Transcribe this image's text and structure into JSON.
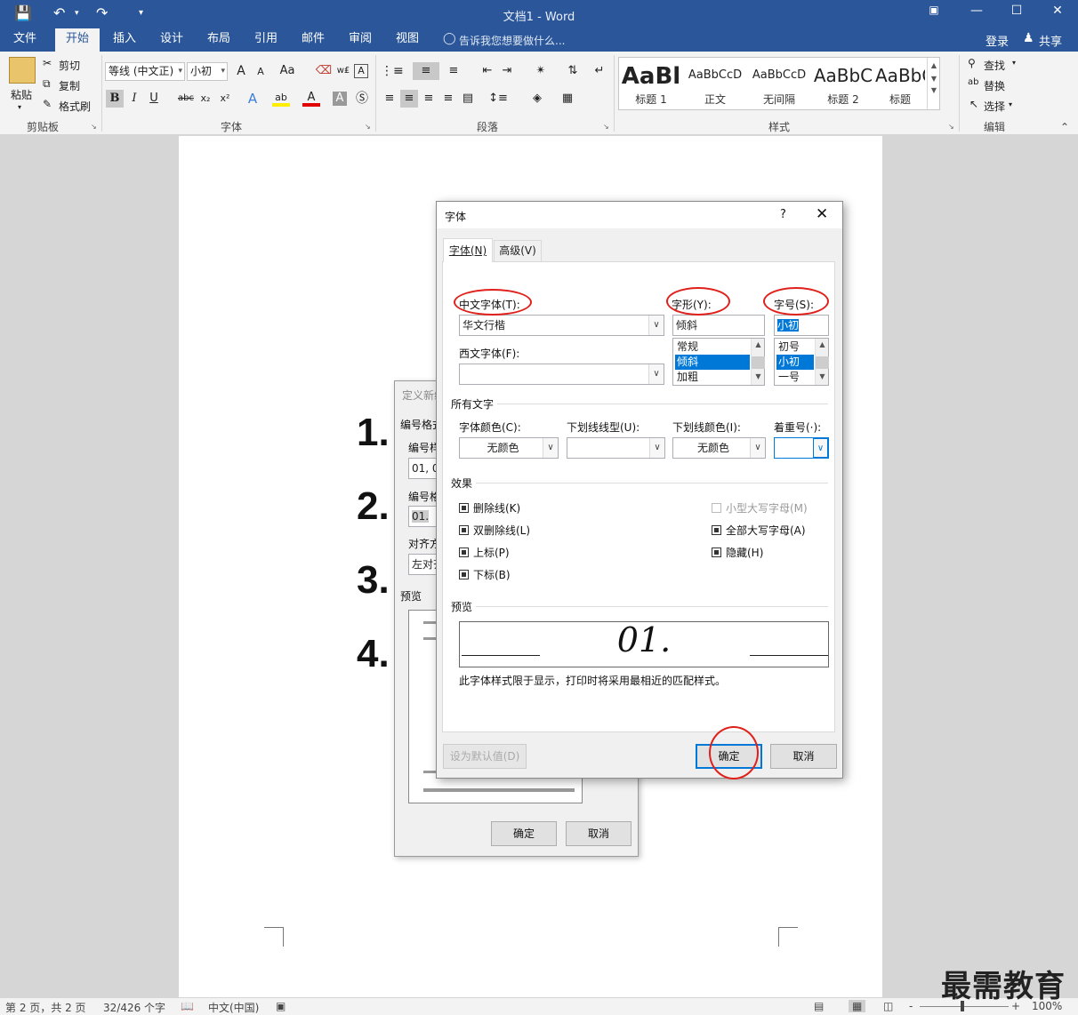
{
  "app": {
    "doc_title": "文档1 - Word",
    "quick_access": [
      "save-icon",
      "undo-icon",
      "redo-icon",
      "customize-icon"
    ]
  },
  "tabs": [
    "文件",
    "开始",
    "插入",
    "设计",
    "布局",
    "引用",
    "邮件",
    "审阅",
    "视图"
  ],
  "tell_me": "告诉我您想要做什么...",
  "account": {
    "login": "登录",
    "share": "共享"
  },
  "ribbon": {
    "clipboard": {
      "paste": "粘贴",
      "cut": "剪切",
      "copy": "复制",
      "format_painter": "格式刷",
      "label": "剪贴板"
    },
    "font": {
      "font_name": "等线 (中文正)",
      "font_size": "小初",
      "grow": "A",
      "shrink": "A",
      "change_case": "Aa",
      "label": "字体",
      "bold": "B",
      "italic": "I",
      "underline": "U",
      "strike": "abc",
      "subscript": "x₂",
      "superscript": "x²"
    },
    "paragraph": {
      "label": "段落"
    },
    "styles": {
      "label": "样式",
      "items": [
        {
          "preview": "AaBl",
          "name": "标题 1"
        },
        {
          "preview": "AaBbCcD",
          "name": "正文"
        },
        {
          "preview": "AaBbCcD",
          "name": "无间隔"
        },
        {
          "preview": "AaBbC",
          "name": "标题 2"
        },
        {
          "preview": "AaBbC",
          "name": "标题"
        }
      ]
    },
    "editing": {
      "find": "查找",
      "replace": "替换",
      "select": "选择",
      "label": "编辑"
    }
  },
  "document": {
    "list_numbers": [
      "1.",
      "2.",
      "3.",
      "4."
    ]
  },
  "back_dialog": {
    "title": "定义新编号格式",
    "number_format_section": "编号格式",
    "number_style_label": "编号样式",
    "number_style_value": "01, 0",
    "number_format_label": "编号格式",
    "number_format_value": "01.",
    "alignment_label": "对齐方式",
    "alignment_value": "左对齐",
    "preview_label": "预览",
    "ok": "确定",
    "cancel": "取消"
  },
  "font_dialog": {
    "title": "字体",
    "help": "?",
    "tabs": [
      "字体(N)",
      "高级(V)"
    ],
    "chinese_font_label": "中文字体(T):",
    "chinese_font_value": "华文行楷",
    "western_font_label": "西文字体(F):",
    "western_font_value": "",
    "style_label": "字形(Y):",
    "style_value": "倾斜",
    "style_options": [
      "常规",
      "倾斜",
      "加粗"
    ],
    "size_label": "字号(S):",
    "size_value": "小初",
    "size_options": [
      "初号",
      "小初",
      "一号"
    ],
    "all_text_section": "所有文字",
    "font_color_label": "字体颜色(C):",
    "font_color_value": "无颜色",
    "underline_style_label": "下划线线型(U):",
    "underline_style_value": "",
    "underline_color_label": "下划线颜色(I):",
    "underline_color_value": "无颜色",
    "emphasis_label": "着重号(·):",
    "emphasis_value": "",
    "effects_section": "效果",
    "effects_left": [
      "删除线(K)",
      "双删除线(L)",
      "上标(P)",
      "下标(B)"
    ],
    "effects_right": [
      "小型大写字母(M)",
      "全部大写字母(A)",
      "隐藏(H)"
    ],
    "preview_section": "预览",
    "preview_text": "01.",
    "preview_note": "此字体样式限于显示，打印时将采用最相近的匹配样式。",
    "set_default": "设为默认值(D)",
    "ok": "确定",
    "cancel": "取消"
  },
  "status": {
    "page": "第 2 页，共 2 页",
    "words": "32/426 个字",
    "language": "中文(中国)",
    "zoom": "100%",
    "zoom_minus": "-",
    "zoom_plus": "+"
  },
  "watermark": "最需教育",
  "colors": {
    "accent": "#2b579a",
    "annotation": "#e0201a",
    "selection": "#0078d7"
  }
}
